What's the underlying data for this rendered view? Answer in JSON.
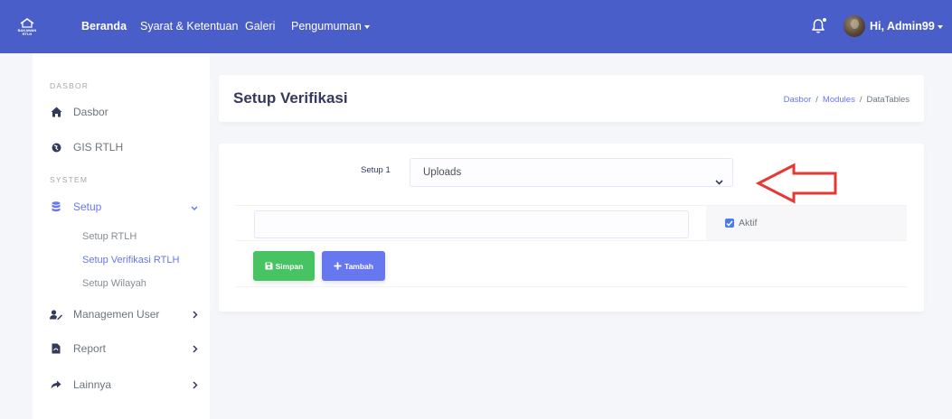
{
  "brand": {
    "text": "BAKAWAN RTLH"
  },
  "navbar": {
    "links": [
      "Beranda",
      "Syarat & Ketentuan",
      "Galeri",
      "Pengumuman"
    ],
    "user_greeting": "Hi, Admin99"
  },
  "sidebar": {
    "header_dasbor": "DASBOR",
    "dasbor": "Dasbor",
    "gis": "GIS RTLH",
    "header_system": "SYSTEM",
    "setup": "Setup",
    "sub_items": [
      "Setup RTLH",
      "Setup Verifikasi RTLH",
      "Setup Wilayah"
    ],
    "managemen_user": "Managemen User",
    "report": "Report",
    "lainnya": "Lainnya"
  },
  "header": {
    "title": "Setup Verifikasi",
    "breadcrumb": [
      "Dasbor",
      "Modules",
      "DataTables"
    ]
  },
  "form": {
    "setup_label": "Setup 1",
    "select_value": "Uploads",
    "text_value": "",
    "checkbox_label": "Aktif",
    "checkbox_checked": true,
    "btn_simpan": "Simpan",
    "btn_tambah": "Tambah"
  },
  "colors": {
    "navbar": "#4a5ec9",
    "primary": "#6777ef",
    "success": "#47c363",
    "arrow": "#e53935"
  }
}
